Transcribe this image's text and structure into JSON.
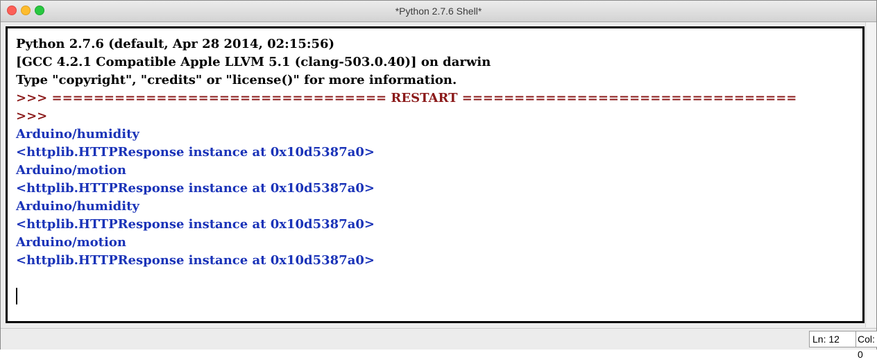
{
  "window": {
    "title": "*Python 2.7.6 Shell*"
  },
  "shell": {
    "lines": [
      {
        "text": "Python 2.7.6 (default, Apr 28 2014, 02:15:56)",
        "style": "std"
      },
      {
        "text": "[GCC 4.2.1 Compatible Apple LLVM 5.1 (clang-503.0.40)] on darwin",
        "style": "std"
      },
      {
        "text": "Type \"copyright\", \"credits\" or \"license()\" for more information.",
        "style": "std"
      },
      {
        "text": ">>> ================================ RESTART ================================",
        "style": "prompt"
      },
      {
        "text": ">>>",
        "style": "prompt"
      },
      {
        "text": "Arduino/humidity",
        "style": "out"
      },
      {
        "text": "<httplib.HTTPResponse instance at 0x10d5387a0>",
        "style": "out"
      },
      {
        "text": "Arduino/motion",
        "style": "out"
      },
      {
        "text": "<httplib.HTTPResponse instance at 0x10d5387a0>",
        "style": "out"
      },
      {
        "text": "Arduino/humidity",
        "style": "out"
      },
      {
        "text": "<httplib.HTTPResponse instance at 0x10d5387a0>",
        "style": "out"
      },
      {
        "text": "Arduino/motion",
        "style": "out"
      },
      {
        "text": "<httplib.HTTPResponse instance at 0x10d5387a0>",
        "style": "out"
      }
    ]
  },
  "status": {
    "line": "Ln: 12",
    "column": "Col: 0"
  },
  "colors": {
    "prompt": "#8b1a1a",
    "output": "#1a33b8",
    "standard": "#000000"
  }
}
